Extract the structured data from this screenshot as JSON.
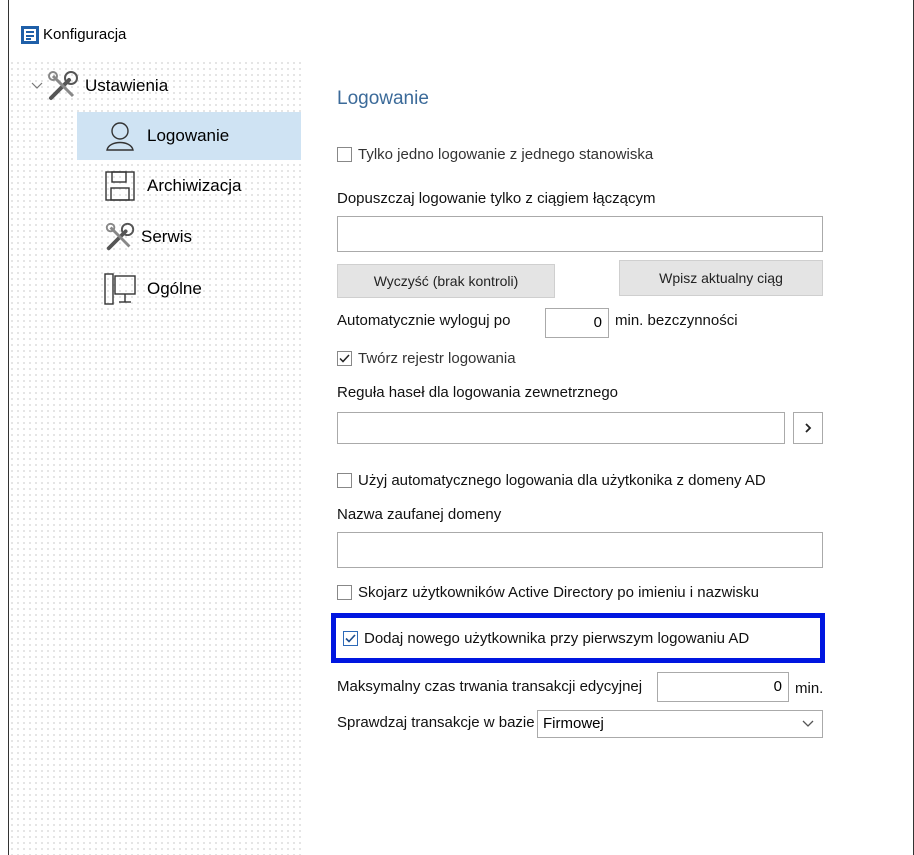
{
  "window": {
    "title": "Konfiguracja"
  },
  "tree": {
    "root": {
      "label": "Ustawienia"
    },
    "items": [
      {
        "label": "Logowanie"
      },
      {
        "label": "Archiwizacja"
      },
      {
        "label": "Serwis"
      },
      {
        "label": "Ogólne"
      }
    ]
  },
  "panel": {
    "heading": "Logowanie",
    "single_login_label": "Tylko jedno logowanie z jednego stanowiska",
    "conn_string_label": "Dopuszczaj logowanie tylko z ciągiem łączącym",
    "conn_string_value": "",
    "clear_button": "Wyczyść (brak kontroli)",
    "insert_button": "Wpisz aktualny ciąg",
    "autologout_label": "Automatycznie wyloguj po",
    "autologout_value": "0",
    "autologout_unit": "min. bezczynności",
    "login_log_label": "Twórz rejestr logowania",
    "password_rule_label": "Reguła haseł dla logowania zewnetrznego",
    "password_rule_value": "",
    "ad_autologin_label": "Użyj automatycznego logowania dla użytkonika z domeny AD",
    "trusted_domain_label": "Nazwa zaufanej domeny",
    "trusted_domain_value": "",
    "pair_ad_label": "Skojarz użytkowników Active Directory po imieniu i nazwisku",
    "add_user_label": "Dodaj  nowego użytkownika przy pierwszym logowaniu AD",
    "max_tx_label": "Maksymalny czas trwania transakcji edycyjnej",
    "max_tx_value": "0",
    "max_tx_unit": "min.",
    "check_tx_label": "Sprawdzaj transakcje w bazie",
    "check_tx_value": "Firmowej"
  },
  "state": {
    "single_login": false,
    "login_log": true,
    "ad_autologin": false,
    "pair_ad": false,
    "add_user": true
  },
  "colors": {
    "heading": "#3b6a99",
    "selection": "#cfe3f3",
    "highlight": "#0016e0"
  }
}
